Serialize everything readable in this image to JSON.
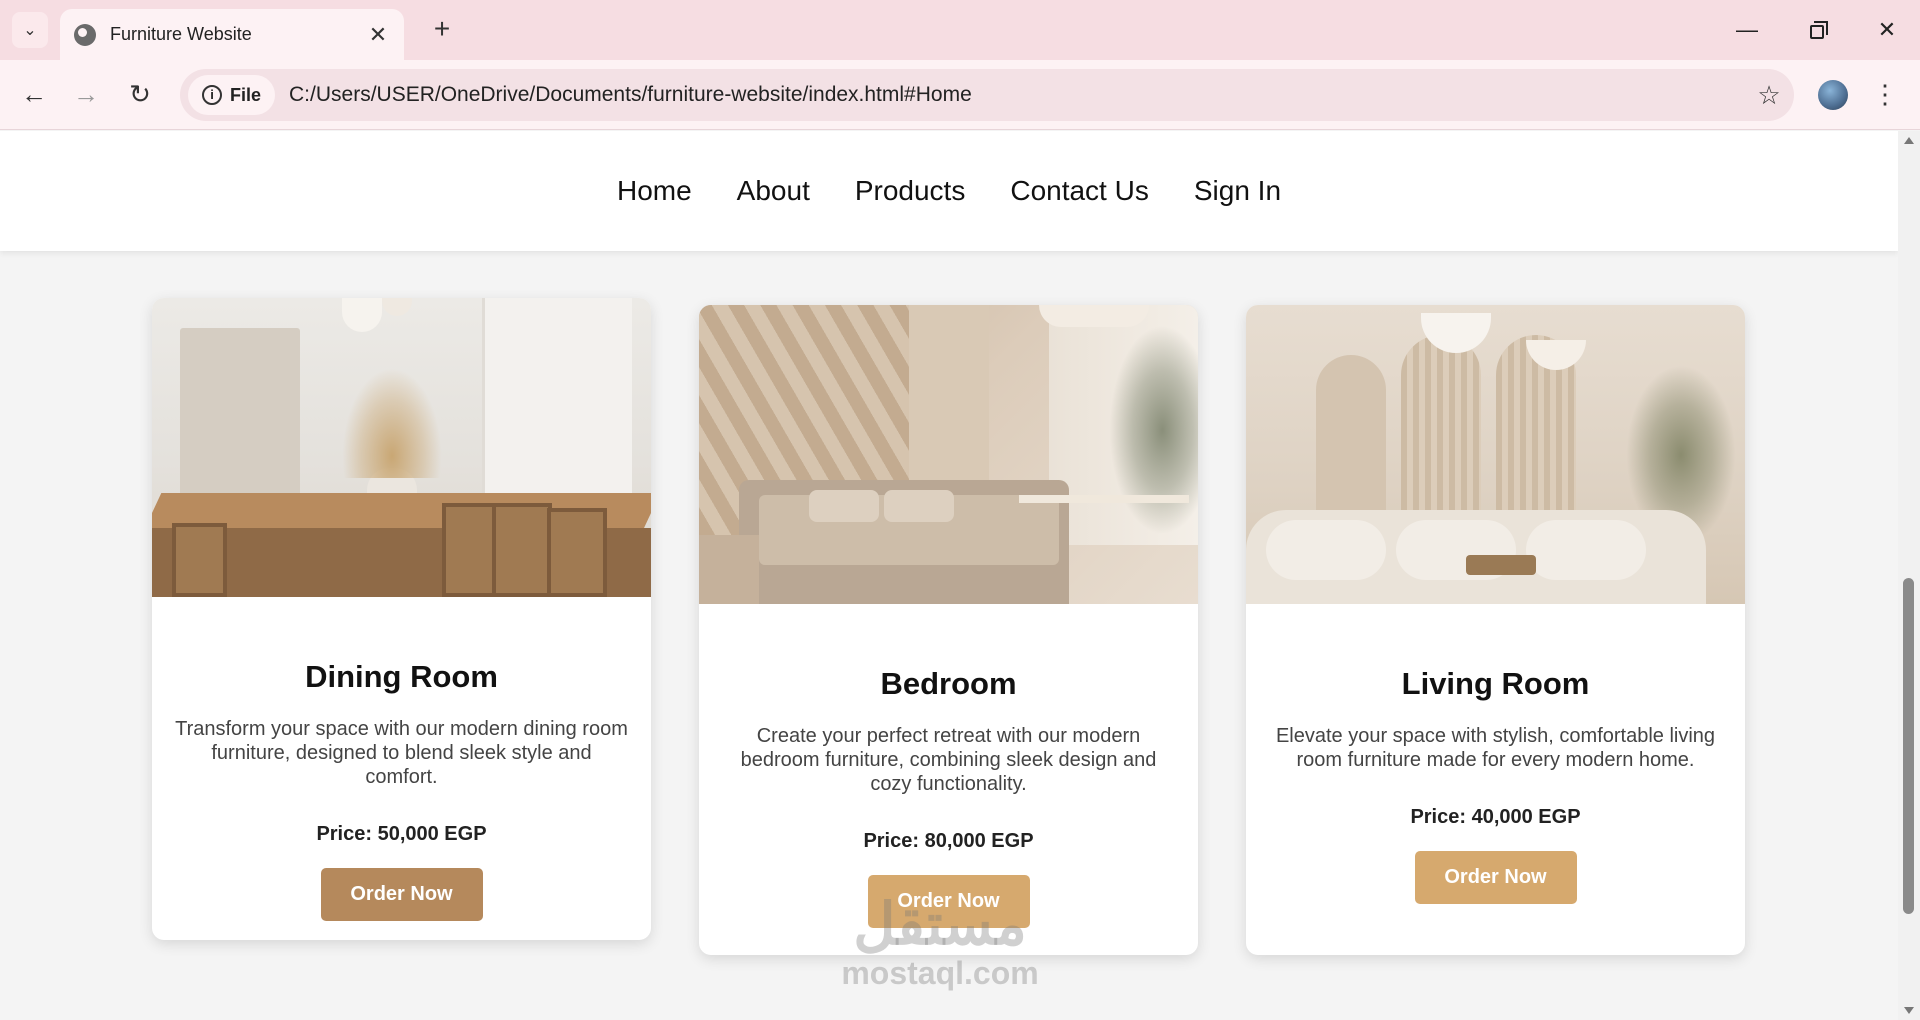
{
  "browser": {
    "tab_title": "Furniture Website",
    "url_chip": "File",
    "url": "C:/Users/USER/OneDrive/Documents/furniture-website/index.html#Home",
    "tab_menu_glyph": "⌄",
    "close_glyph": "✕",
    "new_tab_glyph": "+",
    "minimize_glyph": "—",
    "window_close_glyph": "✕",
    "back_glyph": "←",
    "forward_glyph": "→",
    "reload_glyph": "↻",
    "star_glyph": "☆",
    "kebab_glyph": "⋮",
    "info_glyph": "i"
  },
  "nav": {
    "items": [
      "Home",
      "About",
      "Products",
      "Contact Us",
      "Sign In"
    ]
  },
  "cards": [
    {
      "title": "Dining Room",
      "description": "Transform your space with our modern dining room furniture, designed to blend sleek style and comfort.",
      "price": "Price: 50,000 EGP",
      "button": "Order Now",
      "image_icon": "dining-room-photo"
    },
    {
      "title": "Bedroom",
      "description": "Create your perfect retreat with our modern bedroom furniture, combining sleek design and cozy functionality.",
      "price": "Price: 80,000 EGP",
      "button": "Order Now",
      "image_icon": "bedroom-photo"
    },
    {
      "title": "Living Room",
      "description": "Elevate your space with stylish, comfortable living room furniture made for every modern home.",
      "price": "Price: 40,000 EGP",
      "button": "Order Now",
      "image_icon": "living-room-photo"
    }
  ],
  "watermark": {
    "logo": "مستقل",
    "text": "mostaql.com"
  },
  "colors": {
    "tab_strip": "#f6dde2",
    "toolbar": "#fdf2f4",
    "button_dark": "#b5895c",
    "button_light": "#d6a96e"
  }
}
